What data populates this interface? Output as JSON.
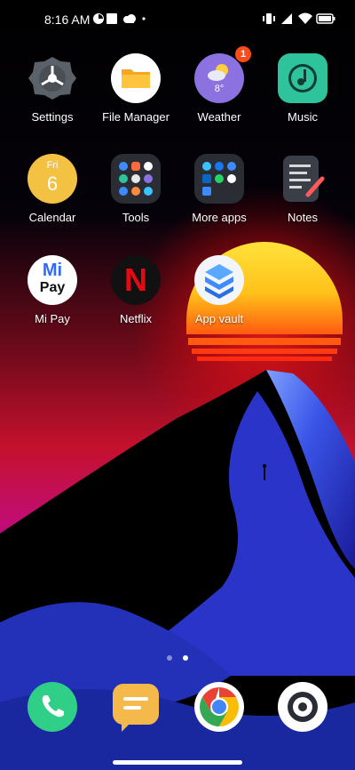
{
  "status_bar": {
    "time": "8:16 AM",
    "left_icons": [
      "sync-icon",
      "notification-square-icon",
      "cloud-icon",
      "dot-icon"
    ],
    "right_icons": [
      "vibrate-icon",
      "signal-icon",
      "wifi-icon",
      "battery-icon"
    ]
  },
  "apps": [
    {
      "id": "settings",
      "label": "Settings",
      "icon": "gear-icon"
    },
    {
      "id": "file-manager",
      "label": "File Manager",
      "icon": "folder-icon"
    },
    {
      "id": "weather",
      "label": "Weather",
      "icon": "weather-icon",
      "badge": "1",
      "temp": "8°"
    },
    {
      "id": "music",
      "label": "Music",
      "icon": "music-icon"
    },
    {
      "id": "calendar",
      "label": "Calendar",
      "icon": "calendar-icon",
      "day": "Fri",
      "date": "6"
    },
    {
      "id": "tools",
      "label": "Tools",
      "icon": "folder-grid-icon"
    },
    {
      "id": "more-apps",
      "label": "More apps",
      "icon": "folder-grid-icon"
    },
    {
      "id": "notes",
      "label": "Notes",
      "icon": "notes-icon"
    },
    {
      "id": "mi-pay",
      "label": "Mi Pay",
      "icon": "mi-pay-icon",
      "mark_top": "Mi",
      "mark_bottom": "Pay"
    },
    {
      "id": "netflix",
      "label": "Netflix",
      "icon": "netflix-icon",
      "mark": "N"
    },
    {
      "id": "app-vault",
      "label": "App vault",
      "icon": "app-vault-icon"
    }
  ],
  "page_indicator": {
    "count": 2,
    "active": 2
  },
  "dock": [
    {
      "id": "phone",
      "icon": "phone-icon"
    },
    {
      "id": "messages",
      "icon": "messages-icon"
    },
    {
      "id": "chrome",
      "icon": "chrome-icon"
    },
    {
      "id": "camera",
      "icon": "camera-icon"
    }
  ],
  "colors": {
    "badge": "#ff4a1c",
    "phone": "#2fcf87",
    "messages": "#f5b84a",
    "music": "#2fc39b",
    "weather": "#8b72e0",
    "calendar": "#f4c242"
  }
}
